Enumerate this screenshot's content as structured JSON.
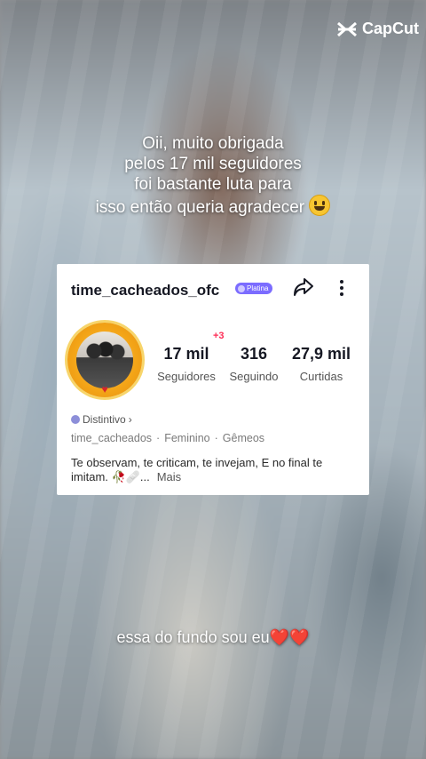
{
  "watermark": {
    "label": "CapCut"
  },
  "caption_top": {
    "lines": [
      "Oii, muito obrigada",
      "pelos 17 mil seguidores",
      "foi bastante luta para",
      "isso então queria agradecer"
    ],
    "emoji": "smiling-face-emoji"
  },
  "profile": {
    "username": "time_cacheados_ofc",
    "badge": "Platina",
    "icons": {
      "share": "share-icon",
      "more": "more-vertical-icon"
    },
    "stats": [
      {
        "value": "17 mil",
        "label": "Seguidores"
      },
      {
        "value": "316",
        "label": "Seguindo"
      },
      {
        "value": "27,9 mil",
        "label": "Curtidas"
      }
    ],
    "new_followers": "+3",
    "distintivo": "Distintivo",
    "meta": [
      "time_cacheados",
      "Feminino",
      "Gêmeos"
    ],
    "bio_line1": "Te observam, te criticam, te invejam, E no final te",
    "bio_line2": "imitam. 🥀🩹...",
    "bio_more": "Mais"
  },
  "caption_bottom": {
    "text": "essa do fundo sou eu❤️❤️"
  },
  "colors": {
    "accent_red": "#fe2c55",
    "badge_purple": "#7b6cff"
  }
}
